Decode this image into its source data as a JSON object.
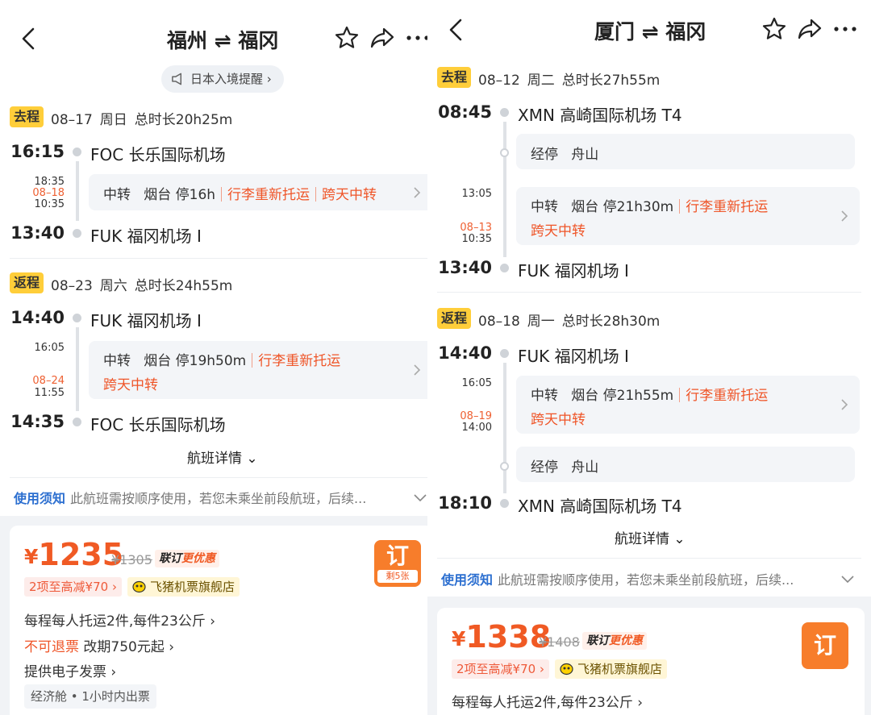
{
  "left": {
    "header": {
      "title": "福州 ⇌ 福冈"
    },
    "notice": "日本入境提醒",
    "outbound": {
      "tag": "去程",
      "date": "08–17",
      "weekday": "周日",
      "duration": "总时长20h25m",
      "depart_time": "16:15",
      "depart_airport": "FOC 长乐国际机场",
      "transfer_arrive": "18:35",
      "transfer_date": "08–18",
      "transfer_depart": "10:35",
      "transfer": {
        "label": "中转",
        "city": "烟台",
        "stay": "停16h",
        "baggage": "行李重新托运",
        "cross_day": "跨天中转"
      },
      "arrive_time": "13:40",
      "arrive_airport": "FUK 福冈机场 I"
    },
    "return": {
      "tag": "返程",
      "date": "08–23",
      "weekday": "周六",
      "duration": "总时长24h55m",
      "depart_time": "14:40",
      "depart_airport": "FUK 福冈机场 I",
      "transfer_arrive": "16:05",
      "transfer_date": "08–24",
      "transfer_depart": "11:55",
      "transfer": {
        "label": "中转",
        "city": "烟台",
        "stay": "停19h50m",
        "baggage": "行李重新托运",
        "cross_day": "跨天中转"
      },
      "arrive_time": "14:35",
      "arrive_airport": "FOC 长乐国际机场"
    },
    "flight_details": "航班详情",
    "usage": {
      "label": "使用须知",
      "text": "此航班需按顺序使用，若您未乘坐前段航班，后续..."
    },
    "offer": {
      "currency": "¥",
      "price": "1235",
      "original": "¥1305",
      "promo_a": "联订",
      "promo_b": "更优惠",
      "discount": "2项至高减¥70",
      "store": "飞猪机票旗舰店",
      "baggage": "每程每人托运2件,每件23公斤",
      "refund": "不可退票",
      "change": "改期750元起",
      "invoice": "提供电子发票",
      "cabin": "经济舱 • 1小时内出票",
      "book": "订",
      "remaining": "剩5张"
    }
  },
  "right": {
    "header": {
      "title": "厦门 ⇌ 福冈"
    },
    "outbound": {
      "tag": "去程",
      "date": "08–12",
      "weekday": "周二",
      "duration": "总时长27h55m",
      "depart_time": "08:45",
      "depart_airport": "XMN 高崎国际机场 T4",
      "stop": {
        "label": "经停",
        "city": "舟山"
      },
      "transfer_arrive": "13:05",
      "transfer_date": "08–13",
      "transfer_depart": "10:35",
      "transfer": {
        "label": "中转",
        "city": "烟台",
        "stay": "停21h30m",
        "baggage": "行李重新托运",
        "cross_day": "跨天中转"
      },
      "arrive_time": "13:40",
      "arrive_airport": "FUK 福冈机场 I"
    },
    "return": {
      "tag": "返程",
      "date": "08–18",
      "weekday": "周一",
      "duration": "总时长28h30m",
      "depart_time": "14:40",
      "depart_airport": "FUK 福冈机场 I",
      "transfer_arrive": "16:05",
      "transfer_date": "08–19",
      "transfer_depart": "14:00",
      "transfer": {
        "label": "中转",
        "city": "烟台",
        "stay": "停21h55m",
        "baggage": "行李重新托运",
        "cross_day": "跨天中转"
      },
      "stop": {
        "label": "经停",
        "city": "舟山"
      },
      "arrive_time": "18:10",
      "arrive_airport": "XMN 高崎国际机场 T4"
    },
    "flight_details": "航班详情",
    "usage": {
      "label": "使用须知",
      "text": "此航班需按顺序使用，若您未乘坐前段航班，后续..."
    },
    "offer": {
      "currency": "¥",
      "price": "1338",
      "original": "¥1408",
      "promo_a": "联订",
      "promo_b": "更优惠",
      "discount": "2项至高减¥70",
      "store": "飞猪机票旗舰店",
      "baggage": "每程每人托运2件,每件23公斤",
      "book": "订"
    }
  },
  "colors": {
    "accent": "#f05a24",
    "tag": "#ffce3a",
    "link": "#2c6fd0",
    "book": "#f77d2b"
  }
}
